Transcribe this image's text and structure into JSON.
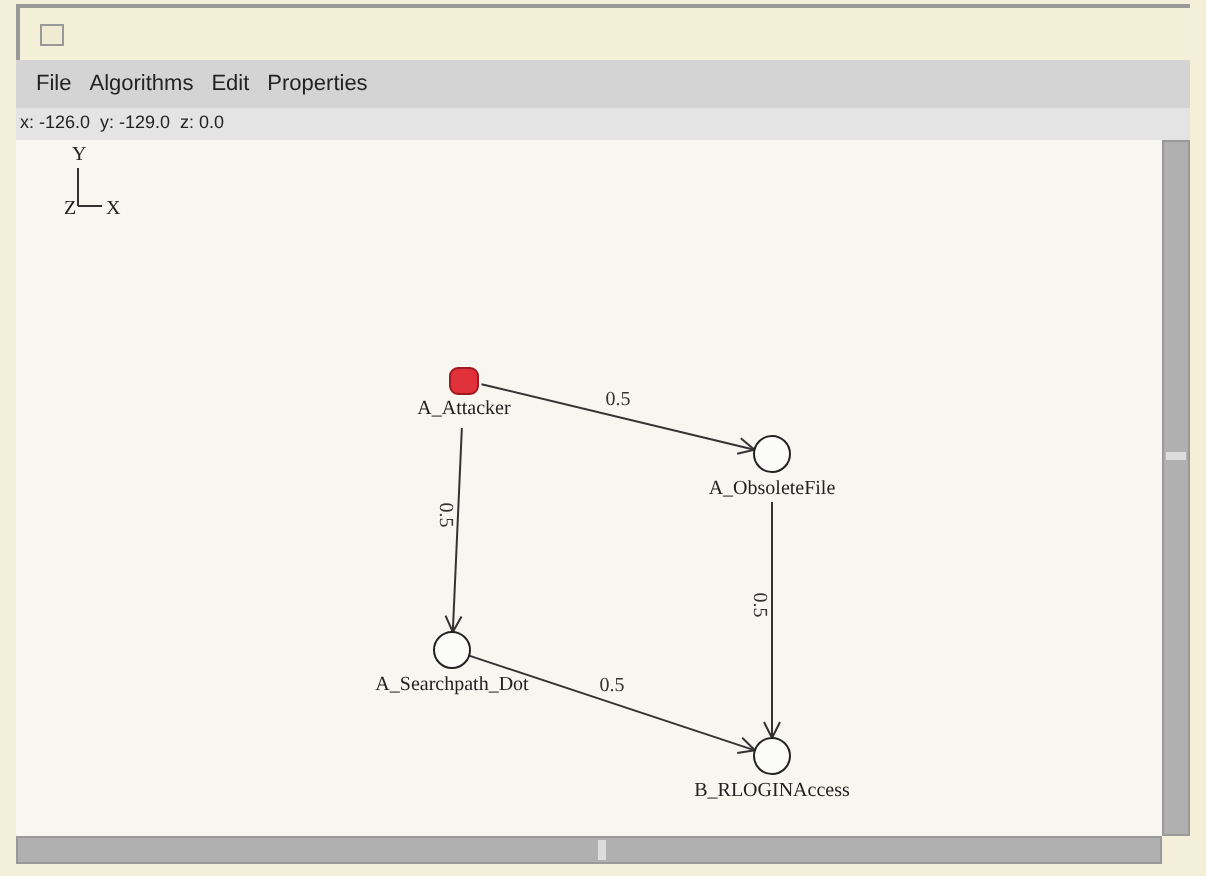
{
  "menu": [
    "File",
    "Algorithms",
    "Edit",
    "Properties"
  ],
  "coordinates": "x: -126.0  y: -129.0  z: 0.0",
  "axes": {
    "y": "Y",
    "z": "Z",
    "x": "X"
  },
  "graph": {
    "nodes": [
      {
        "label": "A_Attacker",
        "kind": "attacker"
      },
      {
        "label": "A_ObsoleteFile",
        "kind": "state"
      },
      {
        "label": "A_Searchpath_Dot",
        "kind": "state"
      },
      {
        "label": "B_RLOGINAccess",
        "kind": "state"
      }
    ],
    "edges": [
      {
        "label": "0.5"
      },
      {
        "label": "0.5"
      },
      {
        "label": "0.5"
      },
      {
        "label": "0.5"
      }
    ]
  }
}
